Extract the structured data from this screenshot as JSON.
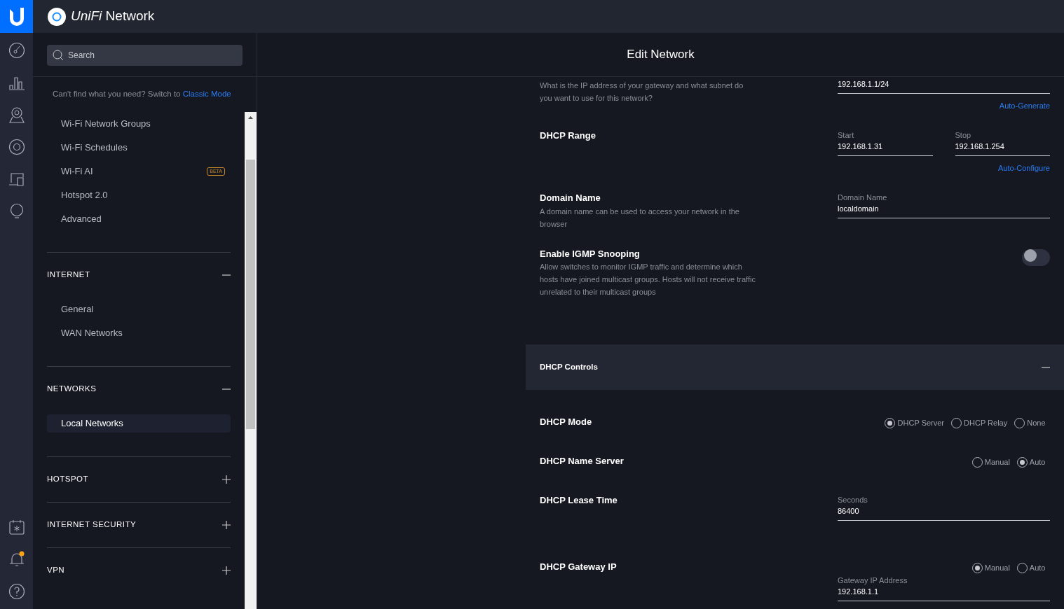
{
  "app": {
    "title": "*UniFi* Network"
  },
  "sidebar": {
    "search": {
      "placeholder": "Search"
    },
    "hint": "Can't find what you need? Switch to",
    "hint_link": "Classic Mode",
    "sections": [
      {
        "items": [
          {
            "label": "Wi-Fi Network Groups",
            "selected": false
          },
          {
            "label": "Wi-Fi Schedules",
            "selected": false
          },
          {
            "label": "Wi-Fi AI",
            "badge": "BETA",
            "selected": false
          },
          {
            "label": "Hotspot 2.0",
            "selected": false
          },
          {
            "label": "Advanced",
            "selected": false
          }
        ]
      },
      {
        "title": "INTERNET",
        "expanded": true,
        "items": [
          {
            "label": "General",
            "selected": false
          },
          {
            "label": "WAN Networks",
            "selected": false
          }
        ]
      },
      {
        "title": "NETWORKS",
        "expanded": true,
        "items": [
          {
            "label": "Local Networks",
            "selected": true
          }
        ]
      },
      {
        "title": "HOTSPOT",
        "expanded": false
      },
      {
        "title": "INTERNET SECURITY",
        "expanded": false
      },
      {
        "title": "VPN",
        "expanded": false
      }
    ]
  },
  "main": {
    "title": "Edit Network",
    "fields": [
      {
        "kind": "input",
        "description": "What is the IP address of your gateway and what subnet do you want to use for this network?",
        "inputs": [
          {
            "value": "192.168.1.1/24"
          }
        ],
        "link": "Auto-Generate"
      },
      {
        "kind": "input",
        "label": "DHCP Range",
        "inputs": [
          {
            "label": "Start",
            "value": "192.168.1.31"
          },
          {
            "label": "Stop",
            "value": "192.168.1.254"
          }
        ],
        "link": "Auto-Configure"
      },
      {
        "kind": "input",
        "label": "Domain Name",
        "description": "A domain name can be used to access your network in the browser",
        "inputs": [
          {
            "label": "Domain Name",
            "value": "localdomain"
          }
        ]
      },
      {
        "kind": "toggle",
        "label": "Enable IGMP Snooping",
        "description": "Allow switches to monitor IGMP traffic and determine which hosts have joined multicast groups. Hosts will not receive traffic unrelated to their multicast groups",
        "on": false
      },
      {
        "kind": "panel",
        "label": "DHCP Controls",
        "expanded": true
      },
      {
        "kind": "radio",
        "label": "DHCP Mode",
        "options": [
          {
            "label": "DHCP Server",
            "selected": true
          },
          {
            "label": "DHCP Relay",
            "selected": false
          },
          {
            "label": "None",
            "selected": false
          }
        ]
      },
      {
        "kind": "radio",
        "label": "DHCP Name Server",
        "options": [
          {
            "label": "Manual",
            "selected": false
          },
          {
            "label": "Auto",
            "selected": true
          }
        ]
      },
      {
        "kind": "input",
        "label": "DHCP Lease Time",
        "inputs": [
          {
            "label": "Seconds",
            "value": "86400"
          }
        ]
      },
      {
        "kind": "radio",
        "label": "DHCP Gateway IP",
        "options": [
          {
            "label": "Manual",
            "selected": true
          },
          {
            "label": "Auto",
            "selected": false
          }
        ],
        "inputs": [
          {
            "label": "Gateway IP Address",
            "value": "192.168.1.1"
          }
        ]
      }
    ]
  }
}
